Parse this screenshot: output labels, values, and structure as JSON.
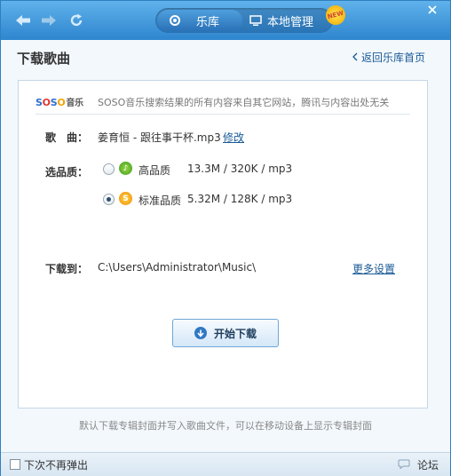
{
  "toolbar": {
    "back_icon": "back-arrow-icon",
    "forward_icon": "forward-arrow-icon",
    "refresh_icon": "refresh-icon",
    "tabs": [
      {
        "label": "乐库",
        "icon": "disc-icon"
      },
      {
        "label": "本地管理",
        "icon": "monitor-icon"
      }
    ],
    "new_badge": "NEW",
    "close_icon": "close-icon"
  },
  "header": {
    "title": "下载歌曲",
    "back_link": "返回乐库首页"
  },
  "panel": {
    "logo": {
      "s1": "S",
      "o1": "O",
      "s2": "S",
      "o2": "O",
      "music": "音乐"
    },
    "disclaimer": "SOSO音乐搜索结果的所有内容来自其它网站，腾讯与内容出处无关",
    "song_label": "歌　曲：",
    "song_name": "姜育恒 - 跟往事干杯.mp3",
    "modify_link": "修改",
    "quality_label": "选品质：",
    "qualities": [
      {
        "name": "高品质",
        "info": "13.3M / 320K / mp3",
        "selected": false,
        "icon": "high-quality-icon"
      },
      {
        "name": "标准品质",
        "info": "5.32M / 128K / mp3",
        "selected": true,
        "icon": "standard-quality-icon"
      }
    ],
    "download_to_label": "下载到：",
    "download_path": "C:\\Users\\Administrator\\Music\\",
    "more_settings": "更多设置",
    "download_button": "开始下载"
  },
  "footer_note": "默认下载专辑封面并写入歌曲文件，可以在移动设备上显示专辑封面",
  "bottom": {
    "dont_show_again": "下次不再弹出",
    "forum": "论坛"
  },
  "colors": {
    "titlebar": "#2f86cf",
    "link": "#1a5a96",
    "panel_border": "#c5d6e6"
  }
}
